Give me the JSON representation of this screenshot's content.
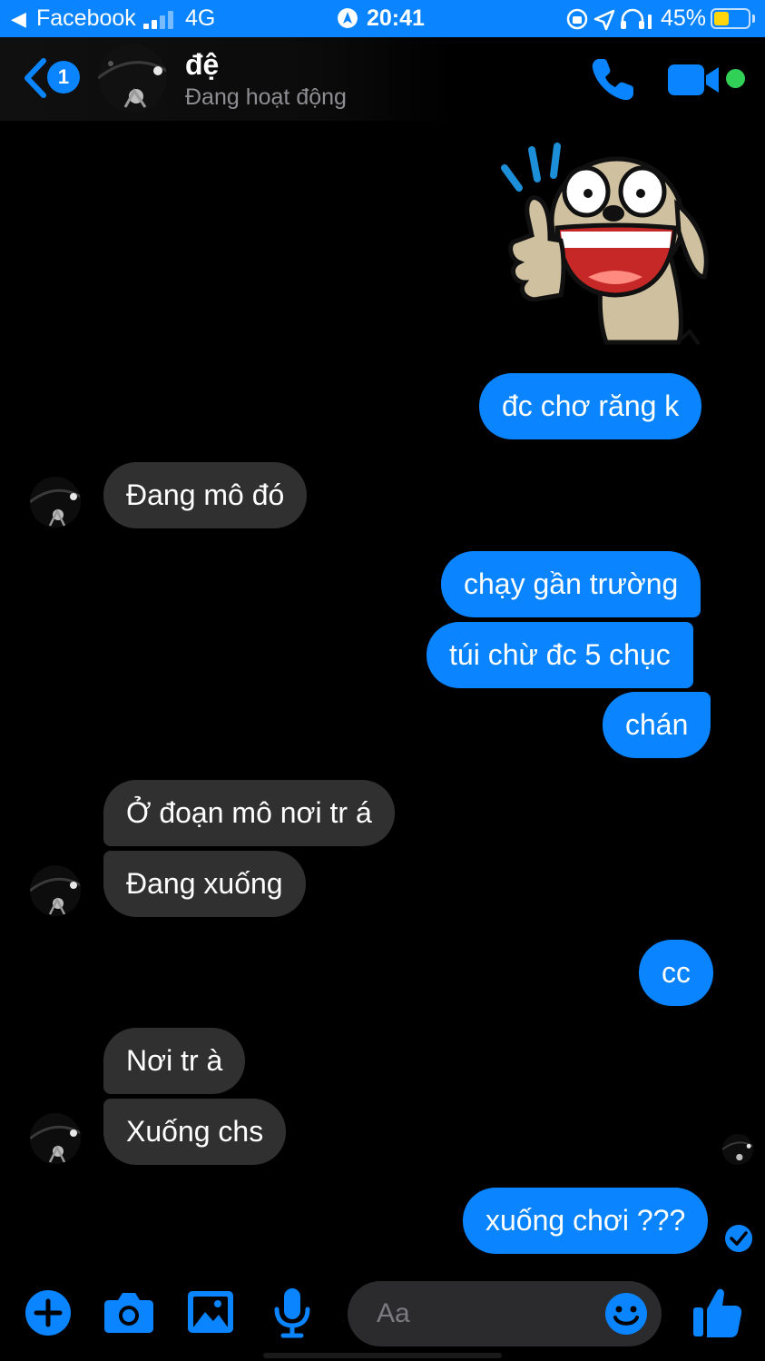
{
  "status_bar": {
    "back_arrow": "◀",
    "back_app": "Facebook",
    "network": "4G",
    "time": "20:41",
    "battery": "45%",
    "battery_level": 0.45,
    "colors": {
      "background": "#0a84ff",
      "battery": "#ffd60a"
    }
  },
  "header": {
    "back_badge": "1",
    "contact_name": "đệ",
    "contact_status": "Đang hoạt động",
    "icons": [
      "back-chevron-icon",
      "phone-icon",
      "video-camera-icon",
      "online-status-dot"
    ],
    "colors": {
      "accent": "#0a84ff",
      "online": "#31d158"
    }
  },
  "conversation": {
    "sticker": {
      "icon": "thumbs-up-dog-sticker",
      "from": "me"
    },
    "messages": [
      {
        "from": "me",
        "text": "đc chơ răng k"
      },
      {
        "from": "contact",
        "text": "Đang mô đó"
      },
      {
        "from": "me",
        "text": "chạy gần trường"
      },
      {
        "from": "me",
        "text": "túi chừ đc 5 chục"
      },
      {
        "from": "me",
        "text": "chán"
      },
      {
        "from": "contact",
        "text": "Ở đoạn mô nơi tr á"
      },
      {
        "from": "contact",
        "text": "Đang xuống"
      },
      {
        "from": "me",
        "text": "cc"
      },
      {
        "from": "contact",
        "text": "Nơi tr à"
      },
      {
        "from": "contact",
        "text": "Xuống chs"
      },
      {
        "from": "me",
        "text": "xuống chơi ???"
      }
    ],
    "colors": {
      "outgoing": "#0a84ff",
      "incoming": "#303030"
    }
  },
  "composer": {
    "placeholder": "Aa",
    "icons": [
      "plus-icon",
      "camera-icon",
      "gallery-icon",
      "microphone-icon",
      "emoji-icon",
      "like-thumb-icon"
    ]
  }
}
